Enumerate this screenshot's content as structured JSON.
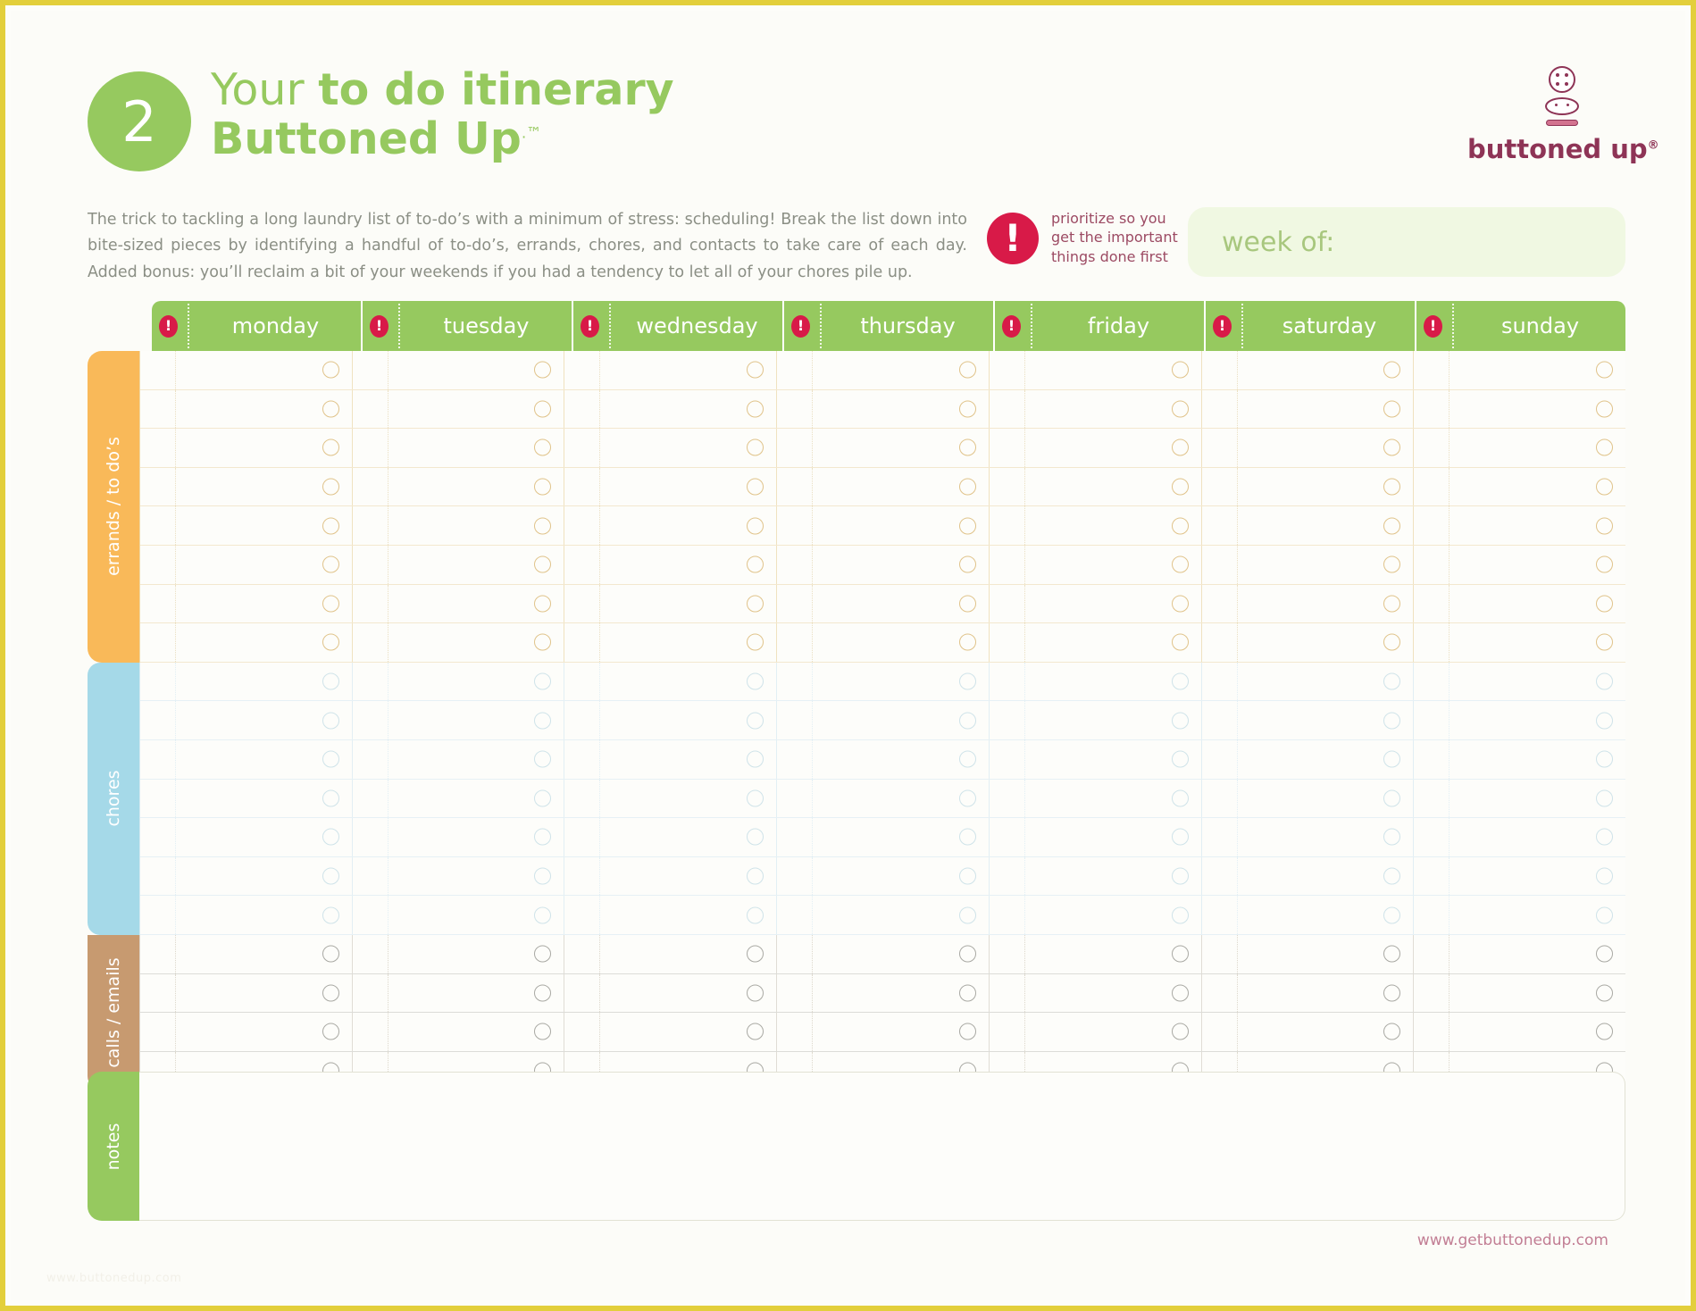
{
  "page": {
    "step_number": "2",
    "title_light": "Your ",
    "title_bold": "to do itinerary",
    "title_line2": "Buttoned Up",
    "title_tm": ".™",
    "border_color": "#e3cf3c",
    "brand_green": "#96c95f",
    "brand_crimson": "#d81a48",
    "brand_plum": "#8e3456"
  },
  "logo": {
    "text": "buttoned up",
    "registered": "®"
  },
  "intro": {
    "paragraph": "The trick to tackling a long laundry list of to-do’s with a minimum of stress: scheduling! Break the list down into bite-sized pieces by identifying a handful of to-do’s, errands, chores, and contacts to take care of each day. Added bonus: you’ll reclaim a bit of your weekends if you had a tendency to let all of your chores pile up."
  },
  "priority_note": {
    "icon": "exclamation-icon",
    "line1": "prioritize so you",
    "line2": "get the important",
    "line3": "things done first"
  },
  "week_of": {
    "label": "week of:",
    "value": ""
  },
  "grid": {
    "days": [
      "monday",
      "tuesday",
      "wednesday",
      "thursday",
      "friday",
      "saturday",
      "sunday"
    ],
    "priority_icon": "!",
    "sections": [
      {
        "key": "errands",
        "label": "errands / to do’s",
        "rows": 8,
        "tab_color": "#f9b959"
      },
      {
        "key": "chores",
        "label": "chores",
        "rows": 7,
        "tab_color": "#a5d9e8"
      },
      {
        "key": "calls",
        "label": "calls / emails",
        "rows": 4,
        "tab_color": "#c79a70"
      }
    ]
  },
  "notes": {
    "label": "notes",
    "value": ""
  },
  "footer": {
    "url": "www.getbuttonedup.com",
    "watermark": "www.buttonedup.com"
  }
}
